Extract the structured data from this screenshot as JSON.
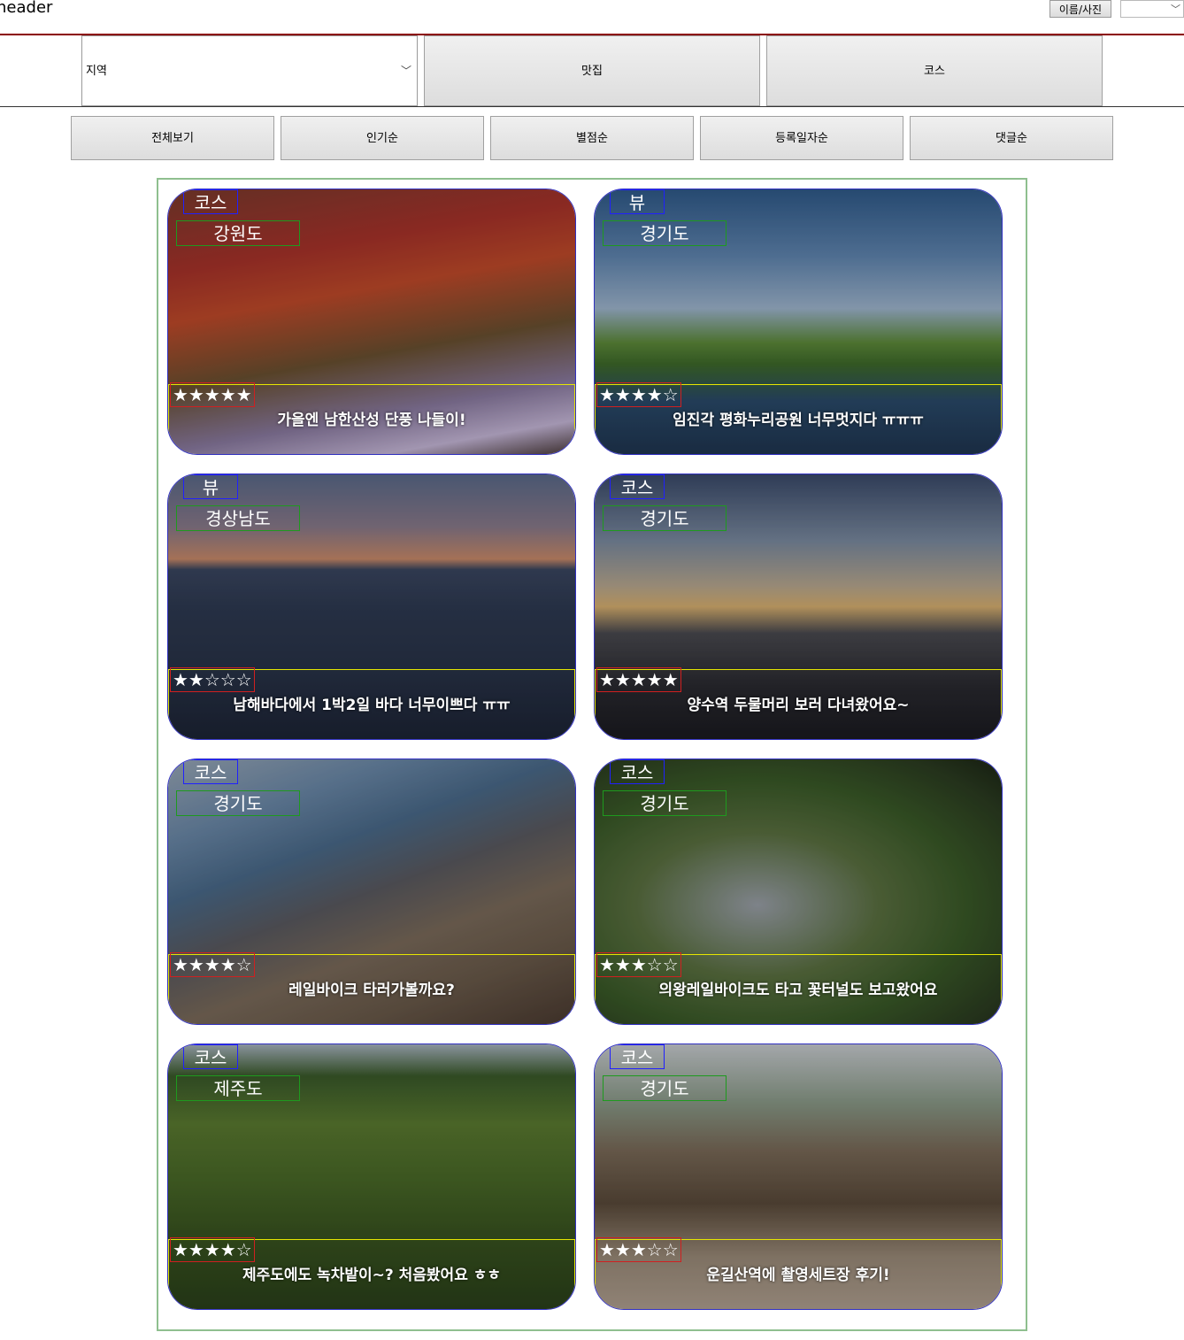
{
  "header": {
    "label": "header",
    "profile_button": "이름/사진"
  },
  "filters": {
    "region_label": "지역",
    "restaurants_label": "맛집",
    "course_label": "코스"
  },
  "sort": [
    "전체보기",
    "인기순",
    "별점순",
    "등록일자순",
    "댓글순"
  ],
  "cards": [
    {
      "type": "코스",
      "region": "강원도",
      "stars": "★★★★★",
      "rating": 5,
      "title": "가을엔 남한산성 단풍 나들이!"
    },
    {
      "type": "뷰",
      "region": "경기도",
      "stars": "★★★★☆",
      "rating": 4,
      "title": "임진각 평화누리공원 너무멋지다 ㅠㅠㅠ"
    },
    {
      "type": "뷰",
      "region": "경상남도",
      "stars": "★★☆☆☆",
      "rating": 2,
      "title": "남해바다에서 1박2일 바다 너무이쁘다 ㅠㅠ"
    },
    {
      "type": "코스",
      "region": "경기도",
      "stars": "★★★★★",
      "rating": 5,
      "title": "양수역 두물머리 보러 다녀왔어요~"
    },
    {
      "type": "코스",
      "region": "경기도",
      "stars": "★★★★☆",
      "rating": 4,
      "title": "레일바이크 타러가볼까요?"
    },
    {
      "type": "코스",
      "region": "경기도",
      "stars": "★★★☆☆",
      "rating": 3,
      "title": "의왕레일바이크도 타고 꽃터널도 보고왔어요"
    },
    {
      "type": "코스",
      "region": "제주도",
      "stars": "★★★★☆",
      "rating": 4,
      "title": "제주도에도 녹차밭이~? 처음봤어요 ㅎㅎ"
    },
    {
      "type": "코스",
      "region": "경기도",
      "stars": "★★★☆☆",
      "rating": 3,
      "title": "운길산역에 촬영세트장 후기!"
    }
  ]
}
